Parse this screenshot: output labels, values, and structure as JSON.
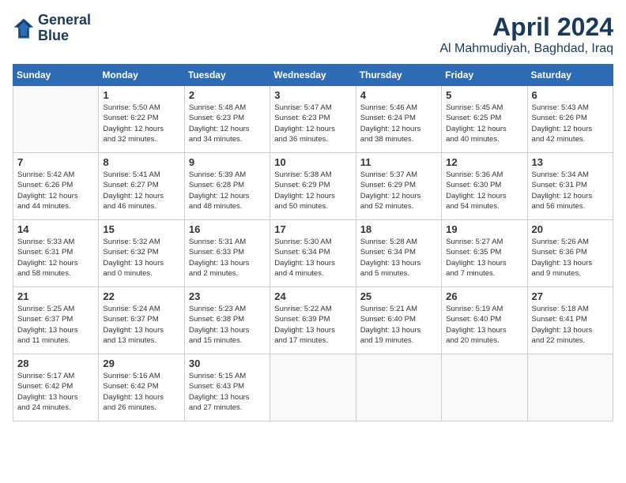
{
  "logo": {
    "line1": "General",
    "line2": "Blue"
  },
  "title": "April 2024",
  "location": "Al Mahmudiyah, Baghdad, Iraq",
  "weekdays": [
    "Sunday",
    "Monday",
    "Tuesday",
    "Wednesday",
    "Thursday",
    "Friday",
    "Saturday"
  ],
  "weeks": [
    [
      {
        "day": "",
        "info": ""
      },
      {
        "day": "1",
        "info": "Sunrise: 5:50 AM\nSunset: 6:22 PM\nDaylight: 12 hours\nand 32 minutes."
      },
      {
        "day": "2",
        "info": "Sunrise: 5:48 AM\nSunset: 6:23 PM\nDaylight: 12 hours\nand 34 minutes."
      },
      {
        "day": "3",
        "info": "Sunrise: 5:47 AM\nSunset: 6:23 PM\nDaylight: 12 hours\nand 36 minutes."
      },
      {
        "day": "4",
        "info": "Sunrise: 5:46 AM\nSunset: 6:24 PM\nDaylight: 12 hours\nand 38 minutes."
      },
      {
        "day": "5",
        "info": "Sunrise: 5:45 AM\nSunset: 6:25 PM\nDaylight: 12 hours\nand 40 minutes."
      },
      {
        "day": "6",
        "info": "Sunrise: 5:43 AM\nSunset: 6:26 PM\nDaylight: 12 hours\nand 42 minutes."
      }
    ],
    [
      {
        "day": "7",
        "info": "Sunrise: 5:42 AM\nSunset: 6:26 PM\nDaylight: 12 hours\nand 44 minutes."
      },
      {
        "day": "8",
        "info": "Sunrise: 5:41 AM\nSunset: 6:27 PM\nDaylight: 12 hours\nand 46 minutes."
      },
      {
        "day": "9",
        "info": "Sunrise: 5:39 AM\nSunset: 6:28 PM\nDaylight: 12 hours\nand 48 minutes."
      },
      {
        "day": "10",
        "info": "Sunrise: 5:38 AM\nSunset: 6:29 PM\nDaylight: 12 hours\nand 50 minutes."
      },
      {
        "day": "11",
        "info": "Sunrise: 5:37 AM\nSunset: 6:29 PM\nDaylight: 12 hours\nand 52 minutes."
      },
      {
        "day": "12",
        "info": "Sunrise: 5:36 AM\nSunset: 6:30 PM\nDaylight: 12 hours\nand 54 minutes."
      },
      {
        "day": "13",
        "info": "Sunrise: 5:34 AM\nSunset: 6:31 PM\nDaylight: 12 hours\nand 56 minutes."
      }
    ],
    [
      {
        "day": "14",
        "info": "Sunrise: 5:33 AM\nSunset: 6:31 PM\nDaylight: 12 hours\nand 58 minutes."
      },
      {
        "day": "15",
        "info": "Sunrise: 5:32 AM\nSunset: 6:32 PM\nDaylight: 13 hours\nand 0 minutes."
      },
      {
        "day": "16",
        "info": "Sunrise: 5:31 AM\nSunset: 6:33 PM\nDaylight: 13 hours\nand 2 minutes."
      },
      {
        "day": "17",
        "info": "Sunrise: 5:30 AM\nSunset: 6:34 PM\nDaylight: 13 hours\nand 4 minutes."
      },
      {
        "day": "18",
        "info": "Sunrise: 5:28 AM\nSunset: 6:34 PM\nDaylight: 13 hours\nand 5 minutes."
      },
      {
        "day": "19",
        "info": "Sunrise: 5:27 AM\nSunset: 6:35 PM\nDaylight: 13 hours\nand 7 minutes."
      },
      {
        "day": "20",
        "info": "Sunrise: 5:26 AM\nSunset: 6:36 PM\nDaylight: 13 hours\nand 9 minutes."
      }
    ],
    [
      {
        "day": "21",
        "info": "Sunrise: 5:25 AM\nSunset: 6:37 PM\nDaylight: 13 hours\nand 11 minutes."
      },
      {
        "day": "22",
        "info": "Sunrise: 5:24 AM\nSunset: 6:37 PM\nDaylight: 13 hours\nand 13 minutes."
      },
      {
        "day": "23",
        "info": "Sunrise: 5:23 AM\nSunset: 6:38 PM\nDaylight: 13 hours\nand 15 minutes."
      },
      {
        "day": "24",
        "info": "Sunrise: 5:22 AM\nSunset: 6:39 PM\nDaylight: 13 hours\nand 17 minutes."
      },
      {
        "day": "25",
        "info": "Sunrise: 5:21 AM\nSunset: 6:40 PM\nDaylight: 13 hours\nand 19 minutes."
      },
      {
        "day": "26",
        "info": "Sunrise: 5:19 AM\nSunset: 6:40 PM\nDaylight: 13 hours\nand 20 minutes."
      },
      {
        "day": "27",
        "info": "Sunrise: 5:18 AM\nSunset: 6:41 PM\nDaylight: 13 hours\nand 22 minutes."
      }
    ],
    [
      {
        "day": "28",
        "info": "Sunrise: 5:17 AM\nSunset: 6:42 PM\nDaylight: 13 hours\nand 24 minutes."
      },
      {
        "day": "29",
        "info": "Sunrise: 5:16 AM\nSunset: 6:42 PM\nDaylight: 13 hours\nand 26 minutes."
      },
      {
        "day": "30",
        "info": "Sunrise: 5:15 AM\nSunset: 6:43 PM\nDaylight: 13 hours\nand 27 minutes."
      },
      {
        "day": "",
        "info": ""
      },
      {
        "day": "",
        "info": ""
      },
      {
        "day": "",
        "info": ""
      },
      {
        "day": "",
        "info": ""
      }
    ]
  ]
}
